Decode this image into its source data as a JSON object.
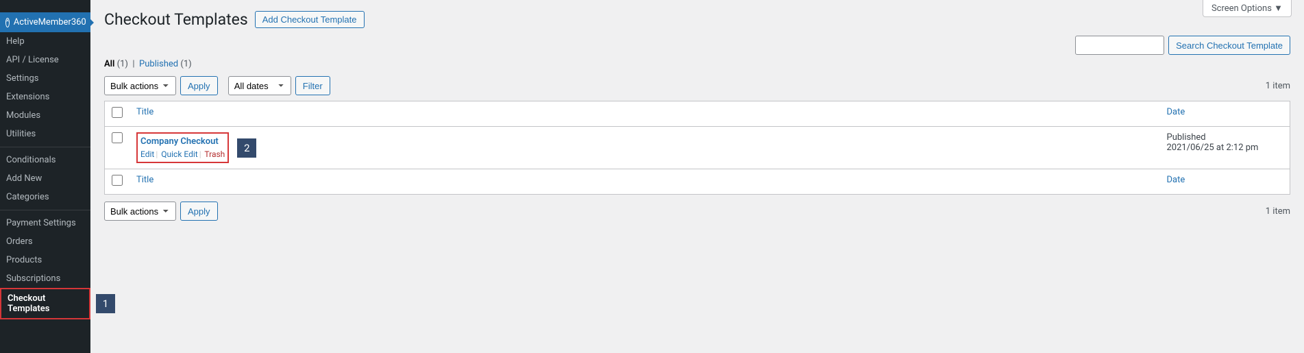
{
  "screen_options": "Screen Options ▼",
  "sidebar": {
    "plugin_name": "ActiveMember360",
    "groups": [
      [
        "Help",
        "API / License",
        "Settings",
        "Extensions",
        "Modules",
        "Utilities"
      ],
      [
        "Conditionals",
        "Add New",
        "Categories"
      ],
      [
        "Payment Settings",
        "Orders",
        "Products",
        "Subscriptions",
        "Checkout Templates"
      ]
    ],
    "active": "Checkout Templates"
  },
  "annotations": {
    "sidebar_num": "1",
    "row_num": "2"
  },
  "header": {
    "title": "Checkout Templates",
    "add_label": "Add Checkout Template"
  },
  "search": {
    "button": "Search Checkout Template",
    "placeholder": ""
  },
  "filters": {
    "all_label": "All",
    "all_count": "(1)",
    "published_label": "Published",
    "published_count": "(1)"
  },
  "bulk": {
    "label": "Bulk actions",
    "apply": "Apply",
    "dates": "All dates",
    "filter": "Filter"
  },
  "count_label": "1 item",
  "columns": {
    "title": "Title",
    "date": "Date"
  },
  "row": {
    "title": "Company Checkout",
    "edit": "Edit",
    "quick": "Quick Edit",
    "trash": "Trash",
    "status": "Published",
    "date": "2021/06/25 at 2:12 pm"
  }
}
